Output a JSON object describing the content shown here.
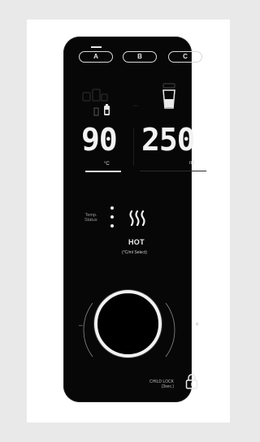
{
  "modes": {
    "a_label": "A",
    "b_label": "B",
    "c_label": "C",
    "active": "A"
  },
  "temperature": {
    "value": "90",
    "unit": "°C"
  },
  "volume": {
    "value": "250",
    "unit": "ml"
  },
  "status": {
    "temp_status_line1": "Temp.",
    "temp_status_line2": "Status",
    "hot_label": "HOT",
    "hot_sub": "(°C/ml Select)"
  },
  "dial": {
    "minus": "–",
    "plus": "+"
  },
  "child_lock": {
    "line1": "CHILD LOCK",
    "line2": "(3sec.)"
  },
  "colors": {
    "panel": "#070707",
    "display": "#f3f3f3",
    "background": "#e9e9e9"
  },
  "icons": [
    "kettle-faint-icon",
    "bottle-icon",
    "glass-icon",
    "steam-icon",
    "lock-icon"
  ]
}
